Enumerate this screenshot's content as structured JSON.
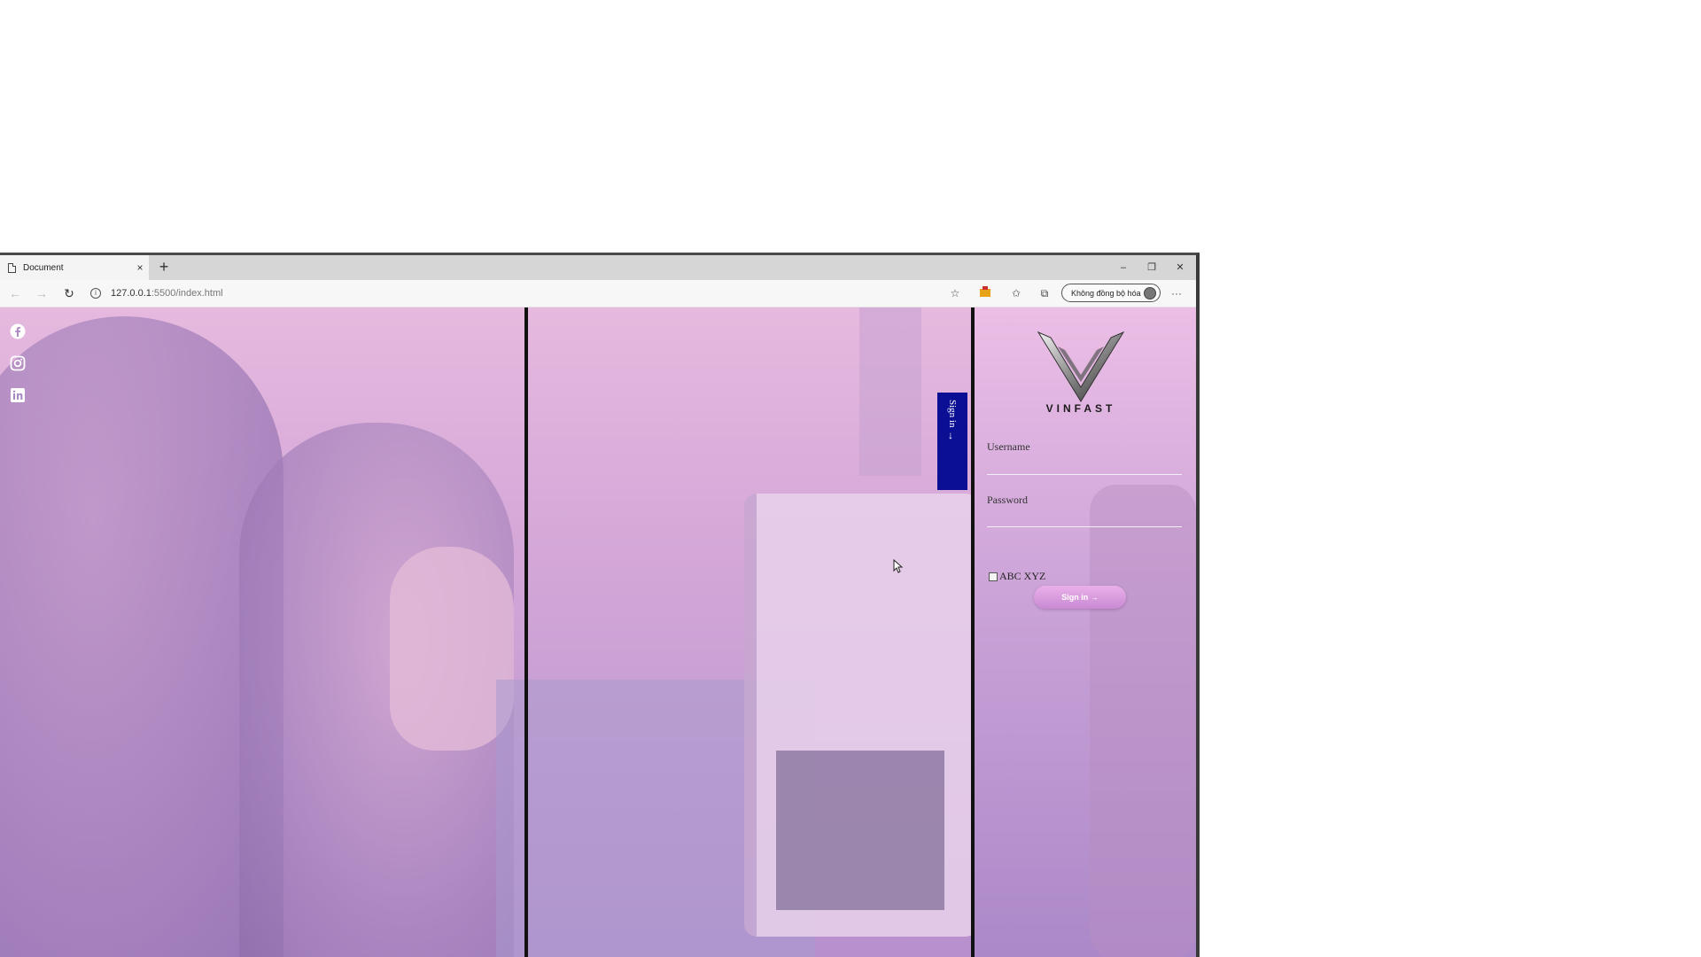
{
  "browser": {
    "tab_title": "Document",
    "tab_close": "×",
    "new_tab": "+",
    "window_controls": {
      "minimize": "–",
      "maximize": "❐",
      "close": "✕"
    },
    "url_host": "127.0.0.1",
    "url_rest": ":5500/index.html",
    "sync_label": "Không đồng bộ hóa",
    "more_menu": "···"
  },
  "page": {
    "sign_in_tab_label": "Sign in",
    "sign_in_tab_arrow": "→",
    "brand": "VINFAST",
    "username_label": "Username",
    "password_label": "Password",
    "remember_label": "ABC XYZ",
    "sign_in_button": "Sign in →"
  },
  "social_icons": [
    "facebook-icon",
    "instagram-icon",
    "linkedin-icon"
  ],
  "colors": {
    "sign_tab_bg": "#0b0f93",
    "button_pink": "#d99be0",
    "overlay_purple": "#c7a0d6"
  }
}
